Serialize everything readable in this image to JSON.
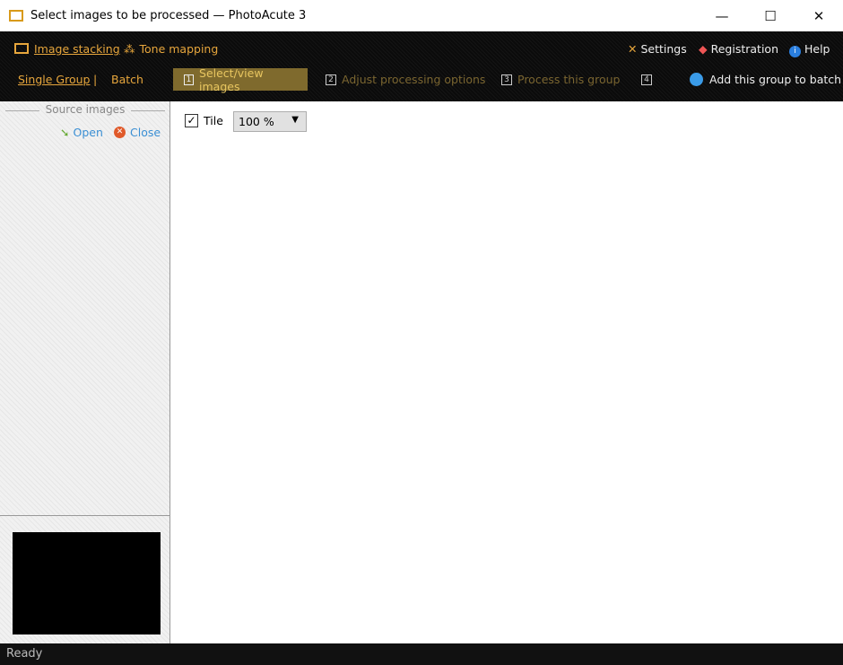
{
  "window": {
    "title": "Select images to be processed — PhotoAcute 3",
    "minimize": "—",
    "maximize": "☐",
    "close": "✕"
  },
  "modes": [
    {
      "label": "Image stacking",
      "icon": "monitor-icon"
    },
    {
      "label": "Tone mapping",
      "icon": "tone-icon"
    }
  ],
  "top_right": [
    {
      "label": "Settings",
      "icon": "tools-icon"
    },
    {
      "label": "Registration",
      "icon": "registration-icon"
    },
    {
      "label": "Help",
      "icon": "info-icon"
    }
  ],
  "group_tabs": {
    "single": "Single Group",
    "separator": "|",
    "batch": "Batch"
  },
  "steps": [
    {
      "num": "1",
      "label": "Select/view images",
      "active": true
    },
    {
      "num": "2",
      "label": "Adjust processing options"
    },
    {
      "num": "3",
      "label": "Process this group"
    },
    {
      "num": "4",
      "label": ""
    }
  ],
  "add_batch": "Add this group to batch",
  "source": {
    "title": "Source images",
    "open": "Open",
    "close": "Close"
  },
  "viewer": {
    "tile_label": "Tile",
    "tile_checked": true,
    "check": "✓",
    "zoom": "100 %"
  },
  "status": "Ready",
  "colors": {
    "accent": "#e7a63c",
    "active_step": "#7f6a2d",
    "link": "#3a8fd4"
  }
}
